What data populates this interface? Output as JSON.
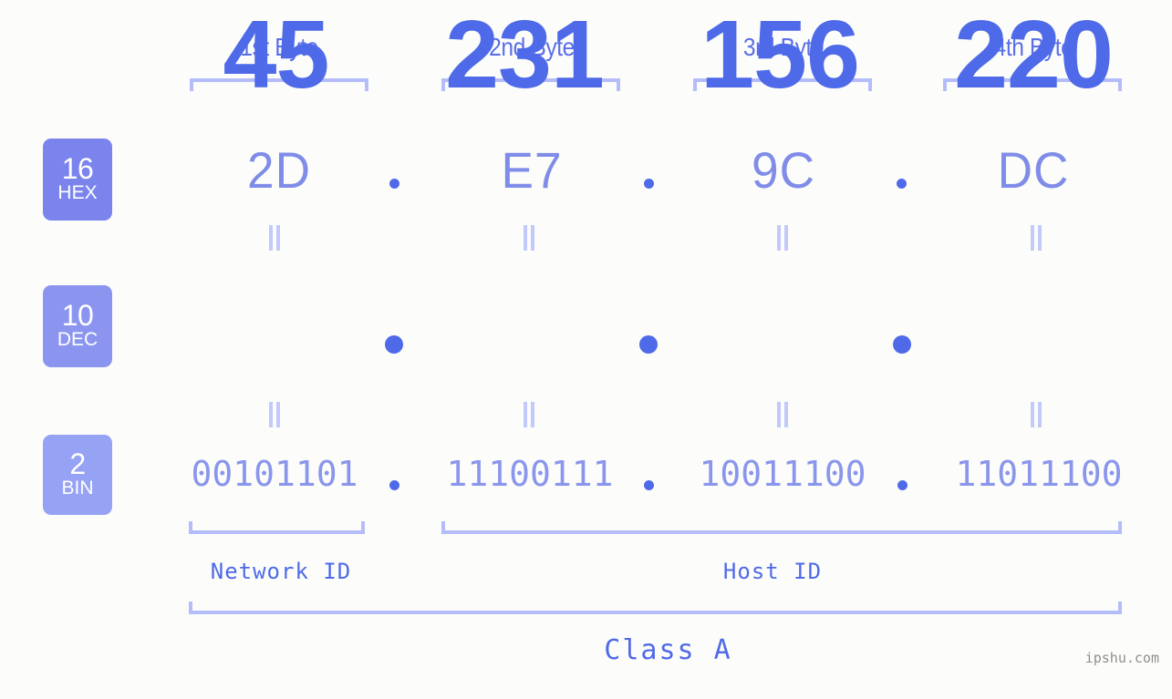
{
  "meta": {
    "watermark": "ipshu.com",
    "background_color": "#fcfdfa",
    "accent_strong": "#4f6ae8",
    "accent_light": "#b4bdfa"
  },
  "byte_headers": [
    {
      "label": "1st Byte"
    },
    {
      "label": "2nd Byte"
    },
    {
      "label": "3rd Byte"
    },
    {
      "label": "4th Byte"
    }
  ],
  "bases": {
    "hex": {
      "radix": "16",
      "name": "HEX",
      "color": "#7b84ed"
    },
    "dec": {
      "radix": "10",
      "name": "DEC",
      "color": "#8b95f0"
    },
    "bin": {
      "radix": "2",
      "name": "BIN",
      "color": "#96a3f5"
    }
  },
  "separator": ".",
  "rows": {
    "hex": [
      "2D",
      "E7",
      "9C",
      "DC"
    ],
    "dec": [
      "45",
      "231",
      "156",
      "220"
    ],
    "bin": [
      "00101101",
      "11100111",
      "10011100",
      "11011100"
    ]
  },
  "segments": {
    "network_id": "Network ID",
    "host_id": "Host ID"
  },
  "class": {
    "label": "Class A"
  }
}
